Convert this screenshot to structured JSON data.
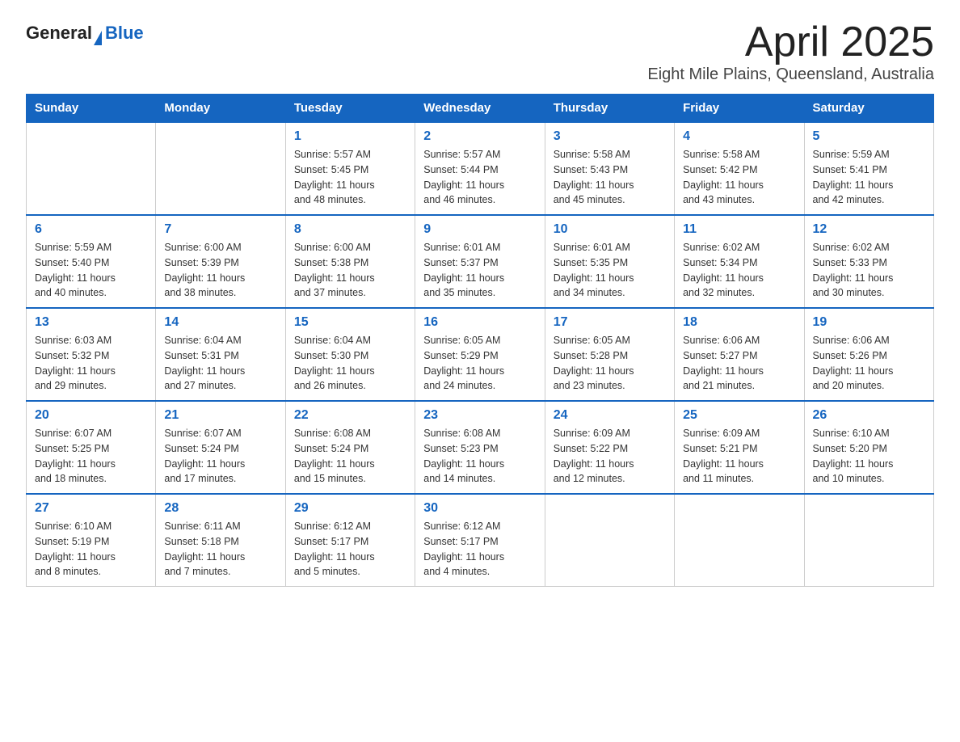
{
  "logo": {
    "general": "General",
    "blue": "Blue"
  },
  "title": "April 2025",
  "subtitle": "Eight Mile Plains, Queensland, Australia",
  "days_of_week": [
    "Sunday",
    "Monday",
    "Tuesday",
    "Wednesday",
    "Thursday",
    "Friday",
    "Saturday"
  ],
  "weeks": [
    [
      {
        "day": "",
        "info": ""
      },
      {
        "day": "",
        "info": ""
      },
      {
        "day": "1",
        "info": "Sunrise: 5:57 AM\nSunset: 5:45 PM\nDaylight: 11 hours\nand 48 minutes."
      },
      {
        "day": "2",
        "info": "Sunrise: 5:57 AM\nSunset: 5:44 PM\nDaylight: 11 hours\nand 46 minutes."
      },
      {
        "day": "3",
        "info": "Sunrise: 5:58 AM\nSunset: 5:43 PM\nDaylight: 11 hours\nand 45 minutes."
      },
      {
        "day": "4",
        "info": "Sunrise: 5:58 AM\nSunset: 5:42 PM\nDaylight: 11 hours\nand 43 minutes."
      },
      {
        "day": "5",
        "info": "Sunrise: 5:59 AM\nSunset: 5:41 PM\nDaylight: 11 hours\nand 42 minutes."
      }
    ],
    [
      {
        "day": "6",
        "info": "Sunrise: 5:59 AM\nSunset: 5:40 PM\nDaylight: 11 hours\nand 40 minutes."
      },
      {
        "day": "7",
        "info": "Sunrise: 6:00 AM\nSunset: 5:39 PM\nDaylight: 11 hours\nand 38 minutes."
      },
      {
        "day": "8",
        "info": "Sunrise: 6:00 AM\nSunset: 5:38 PM\nDaylight: 11 hours\nand 37 minutes."
      },
      {
        "day": "9",
        "info": "Sunrise: 6:01 AM\nSunset: 5:37 PM\nDaylight: 11 hours\nand 35 minutes."
      },
      {
        "day": "10",
        "info": "Sunrise: 6:01 AM\nSunset: 5:35 PM\nDaylight: 11 hours\nand 34 minutes."
      },
      {
        "day": "11",
        "info": "Sunrise: 6:02 AM\nSunset: 5:34 PM\nDaylight: 11 hours\nand 32 minutes."
      },
      {
        "day": "12",
        "info": "Sunrise: 6:02 AM\nSunset: 5:33 PM\nDaylight: 11 hours\nand 30 minutes."
      }
    ],
    [
      {
        "day": "13",
        "info": "Sunrise: 6:03 AM\nSunset: 5:32 PM\nDaylight: 11 hours\nand 29 minutes."
      },
      {
        "day": "14",
        "info": "Sunrise: 6:04 AM\nSunset: 5:31 PM\nDaylight: 11 hours\nand 27 minutes."
      },
      {
        "day": "15",
        "info": "Sunrise: 6:04 AM\nSunset: 5:30 PM\nDaylight: 11 hours\nand 26 minutes."
      },
      {
        "day": "16",
        "info": "Sunrise: 6:05 AM\nSunset: 5:29 PM\nDaylight: 11 hours\nand 24 minutes."
      },
      {
        "day": "17",
        "info": "Sunrise: 6:05 AM\nSunset: 5:28 PM\nDaylight: 11 hours\nand 23 minutes."
      },
      {
        "day": "18",
        "info": "Sunrise: 6:06 AM\nSunset: 5:27 PM\nDaylight: 11 hours\nand 21 minutes."
      },
      {
        "day": "19",
        "info": "Sunrise: 6:06 AM\nSunset: 5:26 PM\nDaylight: 11 hours\nand 20 minutes."
      }
    ],
    [
      {
        "day": "20",
        "info": "Sunrise: 6:07 AM\nSunset: 5:25 PM\nDaylight: 11 hours\nand 18 minutes."
      },
      {
        "day": "21",
        "info": "Sunrise: 6:07 AM\nSunset: 5:24 PM\nDaylight: 11 hours\nand 17 minutes."
      },
      {
        "day": "22",
        "info": "Sunrise: 6:08 AM\nSunset: 5:24 PM\nDaylight: 11 hours\nand 15 minutes."
      },
      {
        "day": "23",
        "info": "Sunrise: 6:08 AM\nSunset: 5:23 PM\nDaylight: 11 hours\nand 14 minutes."
      },
      {
        "day": "24",
        "info": "Sunrise: 6:09 AM\nSunset: 5:22 PM\nDaylight: 11 hours\nand 12 minutes."
      },
      {
        "day": "25",
        "info": "Sunrise: 6:09 AM\nSunset: 5:21 PM\nDaylight: 11 hours\nand 11 minutes."
      },
      {
        "day": "26",
        "info": "Sunrise: 6:10 AM\nSunset: 5:20 PM\nDaylight: 11 hours\nand 10 minutes."
      }
    ],
    [
      {
        "day": "27",
        "info": "Sunrise: 6:10 AM\nSunset: 5:19 PM\nDaylight: 11 hours\nand 8 minutes."
      },
      {
        "day": "28",
        "info": "Sunrise: 6:11 AM\nSunset: 5:18 PM\nDaylight: 11 hours\nand 7 minutes."
      },
      {
        "day": "29",
        "info": "Sunrise: 6:12 AM\nSunset: 5:17 PM\nDaylight: 11 hours\nand 5 minutes."
      },
      {
        "day": "30",
        "info": "Sunrise: 6:12 AM\nSunset: 5:17 PM\nDaylight: 11 hours\nand 4 minutes."
      },
      {
        "day": "",
        "info": ""
      },
      {
        "day": "",
        "info": ""
      },
      {
        "day": "",
        "info": ""
      }
    ]
  ]
}
